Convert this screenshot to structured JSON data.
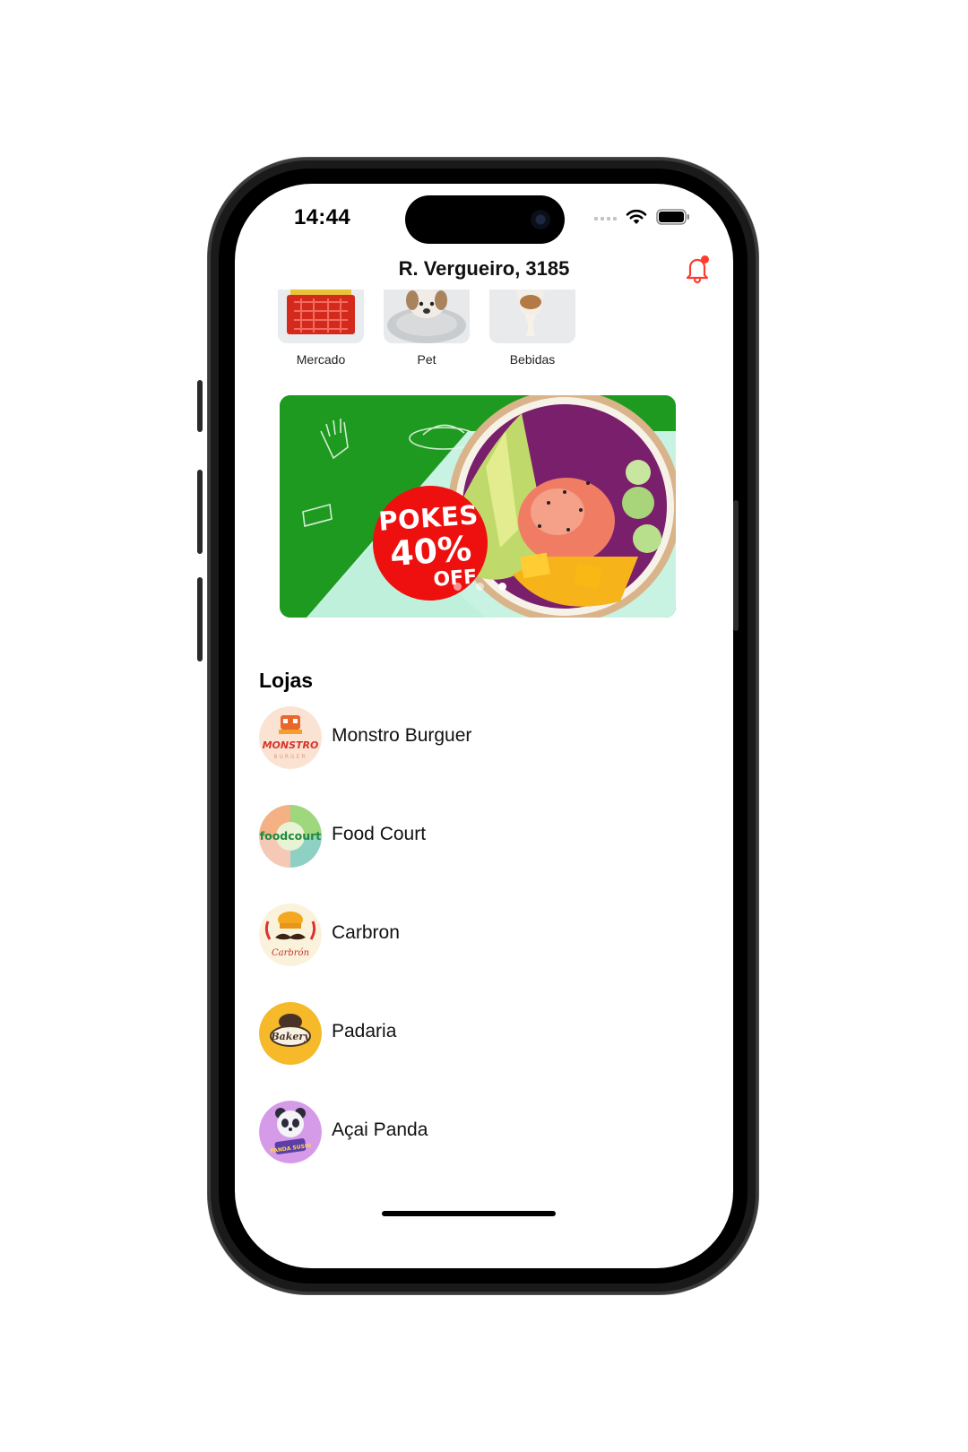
{
  "status_bar": {
    "time": "14:44"
  },
  "header": {
    "address": "R. Vergueiro, 3185"
  },
  "categories": [
    {
      "label": "Mercado",
      "icon": "grocery-basket-icon"
    },
    {
      "label": "Pet",
      "icon": "pet-dog-icon"
    },
    {
      "label": "Bebidas",
      "icon": "drinks-icon"
    }
  ],
  "banner": {
    "line1": "POKES",
    "line2": "40%",
    "line3": "OFF",
    "slides": 3,
    "active_slide": 3
  },
  "stores_section": {
    "title": "Lojas",
    "items": [
      {
        "name": "Monstro Burguer",
        "logo_text": "MONSTRO",
        "logo_sub": "BURGER"
      },
      {
        "name": "Food Court",
        "logo_text": "foodcourt"
      },
      {
        "name": "Carbron",
        "logo_text": "Carbrón"
      },
      {
        "name": "Padaria",
        "logo_text": "Bakery"
      },
      {
        "name": "Açai Panda",
        "logo_text": "PANDA SUSHI"
      }
    ]
  },
  "colors": {
    "accent": "#ff3b30",
    "banner_green": "#1e9a20",
    "badge_red": "#ee0f0f"
  }
}
